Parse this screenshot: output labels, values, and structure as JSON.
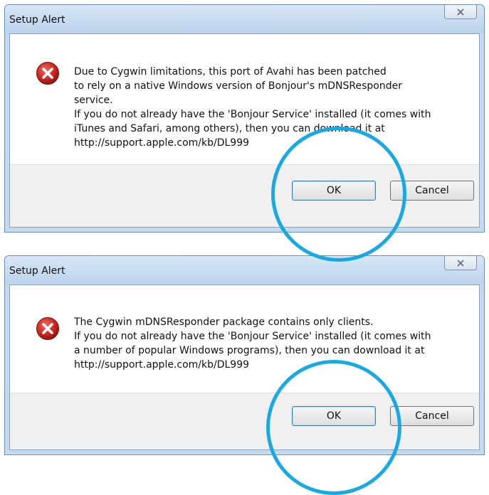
{
  "dialogs": [
    {
      "title": "Setup Alert",
      "message_lines": [
        "Due to Cygwin limitations, this port of Avahi has been patched",
        "to rely on a native Windows version of Bonjour's mDNSResponder",
        "service.",
        "If you do not already have the 'Bonjour Service' installed (it comes with",
        "iTunes and Safari, among others), then you can download it at",
        "http://support.apple.com/kb/DL999"
      ],
      "ok_label": "OK",
      "cancel_label": "Cancel"
    },
    {
      "title": "Setup Alert",
      "message_lines": [
        "The Cygwin mDNSResponder package contains only clients.",
        "If you do not already have the 'Bonjour Service' installed (it comes with",
        "a number of popular Windows programs), then you can download it at",
        "http://support.apple.com/kb/DL999"
      ],
      "ok_label": "OK",
      "cancel_label": "Cancel"
    }
  ],
  "icons": {
    "close": "close-icon",
    "error": "error-icon"
  },
  "colors": {
    "highlight_circle": "#19a9e2",
    "error_red": "#c8211b",
    "title_bar": "#c3d9ef"
  }
}
